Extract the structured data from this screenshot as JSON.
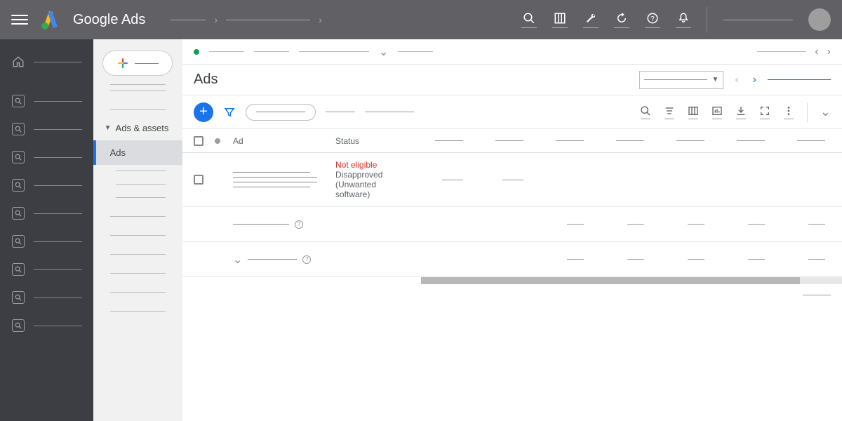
{
  "brand": "Google Ads",
  "panel": {
    "group_label": "Ads & assets",
    "active_item": "Ads"
  },
  "main": {
    "title": "Ads",
    "columns": {
      "ad": "Ad",
      "status": "Status"
    },
    "row1": {
      "status_main": "Not eligible",
      "status_sub": "Disapproved (Unwanted software)"
    }
  }
}
